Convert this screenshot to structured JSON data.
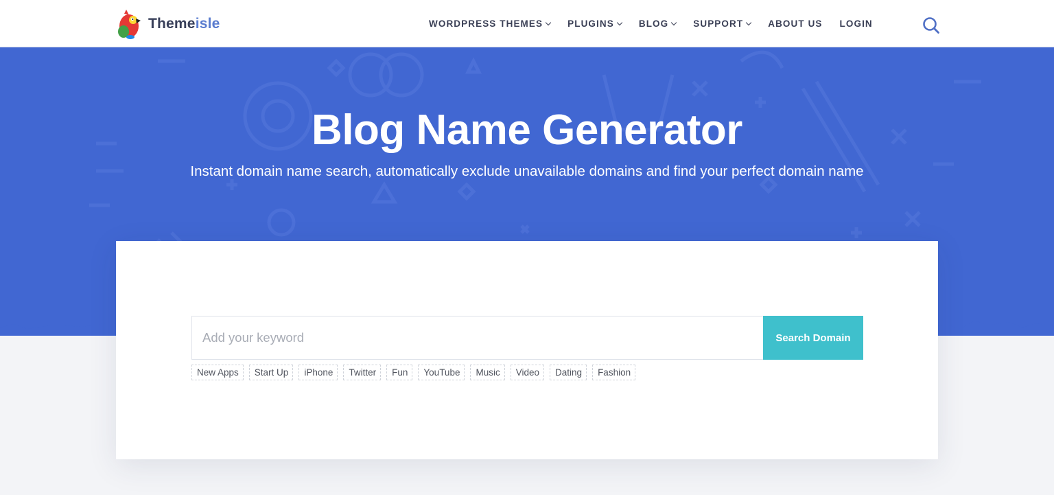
{
  "brand": {
    "name_part1": "Theme",
    "name_part2": "isle"
  },
  "nav": {
    "items": [
      {
        "label": "WORDPRESS THEMES",
        "dropdown": true
      },
      {
        "label": "PLUGINS",
        "dropdown": true
      },
      {
        "label": "BLOG",
        "dropdown": true
      },
      {
        "label": "SUPPORT",
        "dropdown": true
      },
      {
        "label": "ABOUT US",
        "dropdown": false
      },
      {
        "label": "LOGIN",
        "dropdown": false
      }
    ],
    "search_icon": "search-icon"
  },
  "hero": {
    "title": "Blog Name Generator",
    "subtitle": "Instant domain name search, automatically exclude unavailable domains and find your perfect domain name"
  },
  "search": {
    "placeholder": "Add your keyword",
    "value": "",
    "button_label": "Search Domain"
  },
  "tags": [
    "New Apps",
    "Start Up",
    "iPhone",
    "Twitter",
    "Fun",
    "YouTube",
    "Music",
    "Video",
    "Dating",
    "Fashion"
  ],
  "colors": {
    "hero_blue": "#4167d2",
    "accent_teal": "#3fc0cc",
    "nav_text": "#3a3f55",
    "brand_isle": "#5a7ccf",
    "page_bg": "#f3f4f7"
  }
}
